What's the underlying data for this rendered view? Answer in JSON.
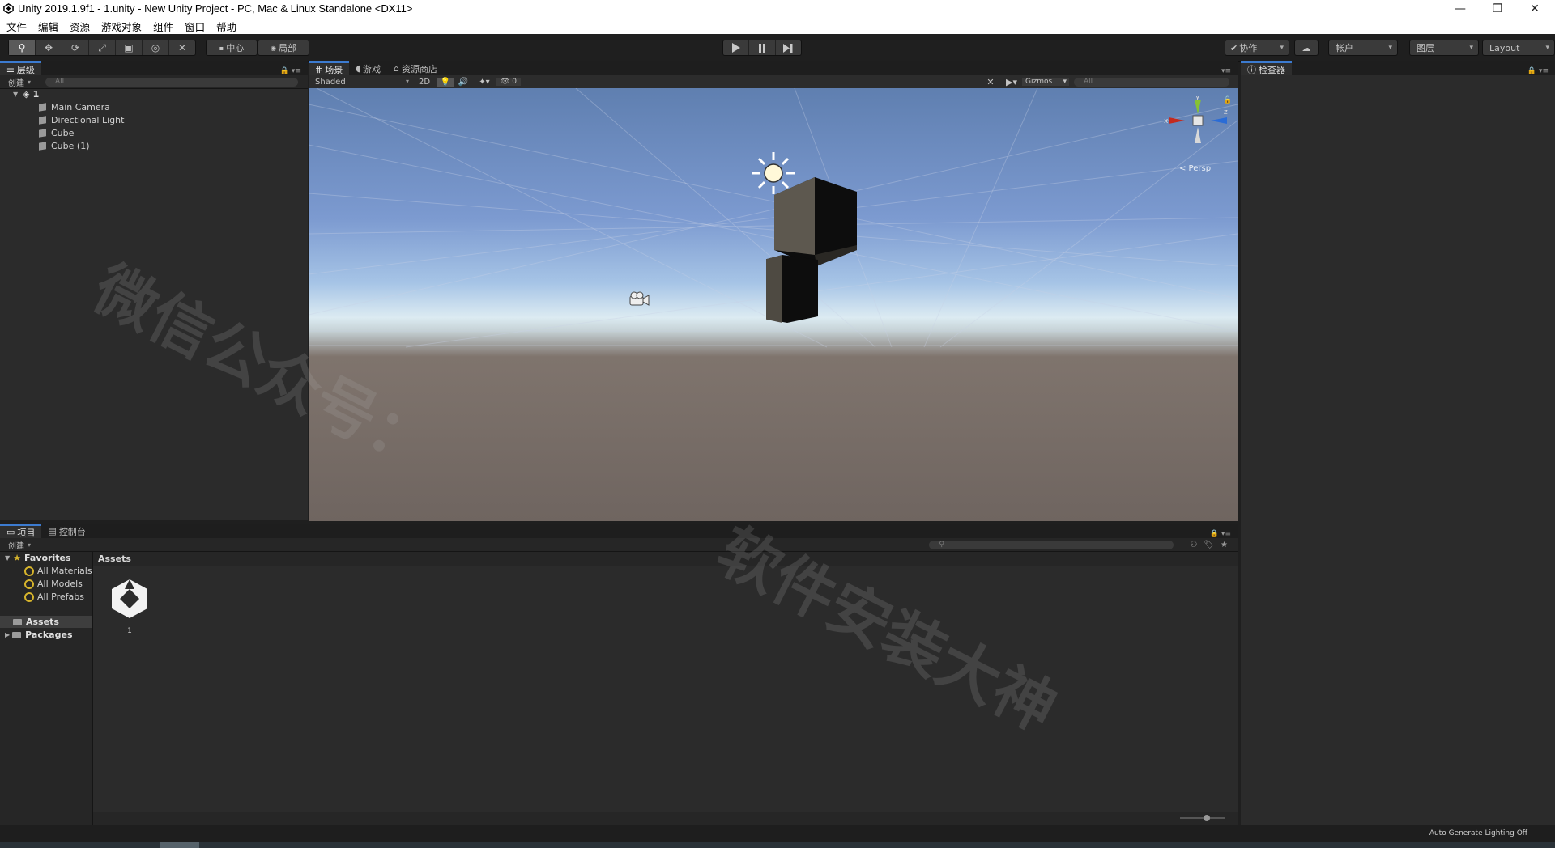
{
  "titlebar": {
    "title": "Unity 2019.1.9f1 - 1.unity - New Unity Project - PC, Mac & Linux Standalone <DX11>",
    "minimize": "—",
    "restore": "❐",
    "close": "✕"
  },
  "menu": [
    "文件",
    "编辑",
    "资源",
    "游戏对象",
    "组件",
    "窗口",
    "帮助"
  ],
  "toolbar": {
    "pivot_center": "中心",
    "pivot_local": "局部",
    "collab": "协作",
    "account": "帐户",
    "layers": "图层",
    "layout": "Layout"
  },
  "hierarchy": {
    "tab": "层级",
    "create": "创建",
    "search_placeholder": "All",
    "scene_name": "1",
    "items": [
      "Main Camera",
      "Directional Light",
      "Cube",
      "Cube (1)"
    ]
  },
  "scene": {
    "tabs": {
      "scene": "场景",
      "game": "游戏",
      "store": "资源商店"
    },
    "shading": "Shaded",
    "mode_2d": "2D",
    "hidden_count": "0",
    "gizmos": "Gizmos",
    "search_placeholder": "All",
    "persp": "< Persp",
    "axis_x": "x",
    "axis_y": "y",
    "axis_z": "z"
  },
  "inspector": {
    "tab": "检查器"
  },
  "project": {
    "tabs": {
      "project": "项目",
      "console": "控制台"
    },
    "create": "创建",
    "favorites": "Favorites",
    "fav_items": [
      "All Materials",
      "All Models",
      "All Prefabs"
    ],
    "tree": [
      "Assets",
      "Packages"
    ],
    "breadcrumb": "Assets",
    "asset_name": "1"
  },
  "status": {
    "lighting": "Auto Generate Lighting Off"
  },
  "watermark": {
    "line1": "微信公众号：",
    "line2": "软件安装大神"
  },
  "colors": {
    "accent": "#3c7bd0",
    "bg_dark": "#1f1f1f",
    "panel": "#2b2b2b",
    "fav_star": "#d6b42c"
  }
}
